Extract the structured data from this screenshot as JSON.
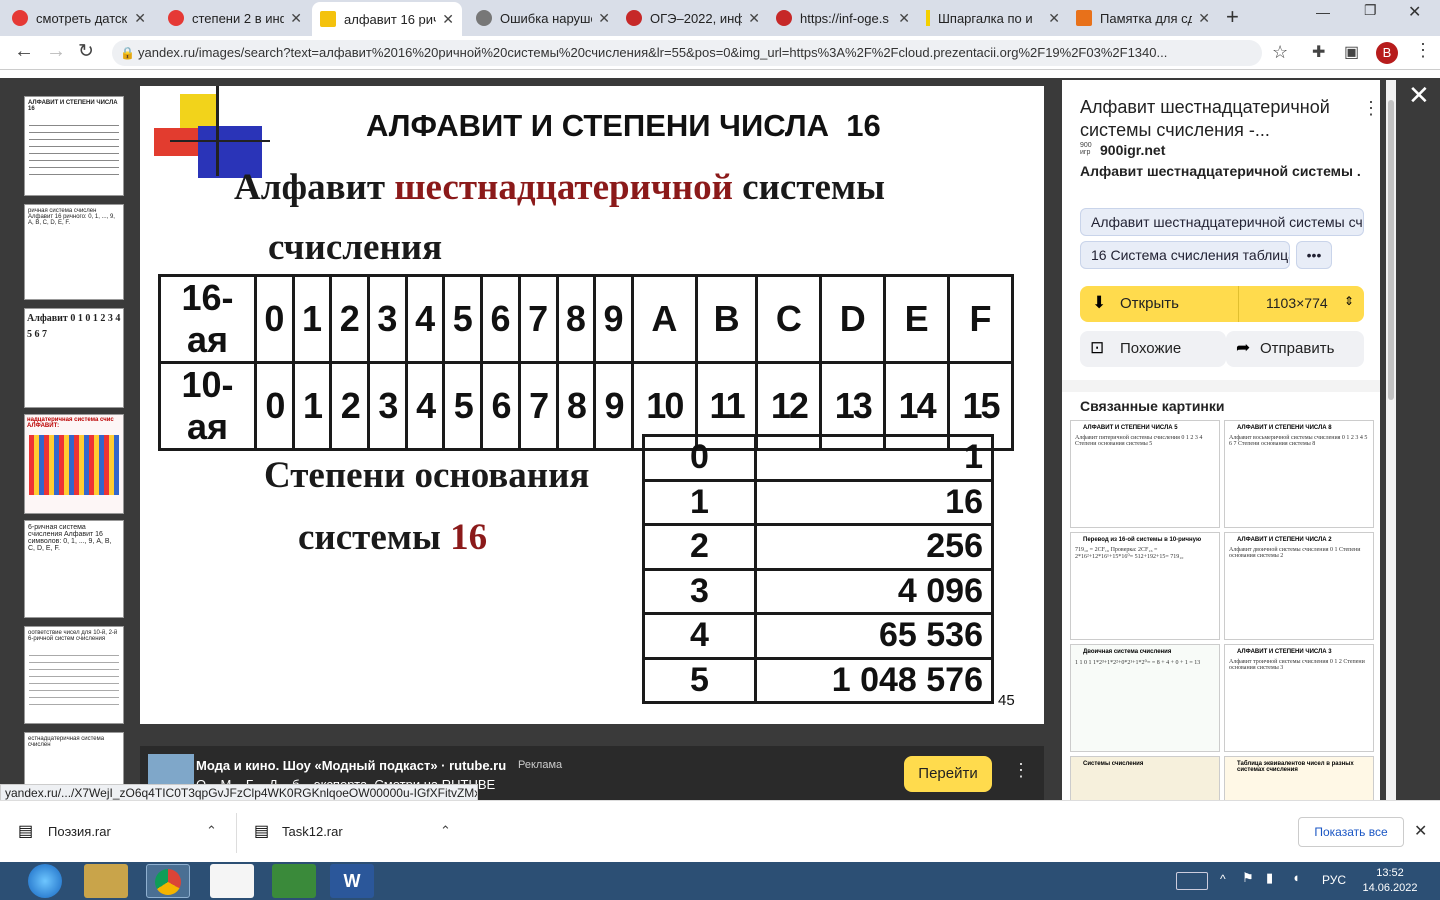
{
  "tabs": [
    {
      "label": "смотреть датск",
      "color": "#e53935"
    },
    {
      "label": "степени 2 в инф",
      "color": "#e53935"
    },
    {
      "label": "алфавит 16 рич",
      "color": "#f4c20d"
    },
    {
      "label": "Ошибка наруше",
      "color": "#777777"
    },
    {
      "label": "ОГЭ–2022, инф",
      "color": "#c62828"
    },
    {
      "label": "https://inf-oge.s",
      "color": "#c62828"
    },
    {
      "label": "Шпаргалка по и",
      "color": "#f4d000"
    },
    {
      "label": "Памятка для сд",
      "color": "#e8711a"
    }
  ],
  "address": "yandex.ru/images/search?text=алфавит%2016%20ричной%20системы%20счисления&lr=55&pos=0&img_url=https%3A%2F%2Fcloud.prezentacii.org%2F19%2F03%2F1340...",
  "profile_letter": "В",
  "thumbs": [
    {
      "text": "АЛФАВИТ И СТЕПЕНИ ЧИСЛА 16"
    },
    {
      "text": "ричная система счислен Алфавит 16 ричного: 0, 1, ..., 9, A, B, C, D, E, F."
    },
    {
      "text": "Алфавит 0 1 0 1 2 3 4 5 6 7"
    },
    {
      "text": "надцатеричная система счис АЛФАВИТ:"
    },
    {
      "text": "6-ричная система счисления Алфавит 16 символов: 0, 1, ..., 9, A, B, C, D, E, F."
    },
    {
      "text": "оответствие чисел для 10-й, 2-й 6-ричной систем счисления"
    },
    {
      "text": "естнадцатеричная система счислен"
    }
  ],
  "slide": {
    "title": "АЛФАВИТ И СТЕПЕНИ ЧИСЛА  16",
    "subtitle_part1": "Алфавит ",
    "subtitle_accent": "шестнадцатеричной",
    "subtitle_part2": " системы",
    "subtitle_line2": "счисления",
    "hex_row_label": "16-ая",
    "dec_row_label": "10-ая",
    "hex_digits": [
      "0",
      "1",
      "2",
      "3",
      "4",
      "5",
      "6",
      "7",
      "8",
      "9",
      "A",
      "B",
      "C",
      "D",
      "E",
      "F"
    ],
    "dec_values": [
      "0",
      "1",
      "2",
      "3",
      "4",
      "5",
      "6",
      "7",
      "8",
      "9",
      "10",
      "11",
      "12",
      "13",
      "14",
      "15"
    ],
    "powers_title_line1": "Степени основания",
    "powers_title_line2": "системы ",
    "powers_base": "16",
    "exponents": [
      "0",
      "1",
      "2",
      "3",
      "4",
      "5"
    ],
    "powers": [
      "1",
      "16",
      "256",
      "4 096",
      "65 536",
      "1 048 576"
    ],
    "page_number": "45"
  },
  "panel": {
    "title": "Алфавит шестнадцатеричной системы счисления -...",
    "site_badge": "900 игр",
    "site": "900igr.net",
    "description_part1": "Алфавит ",
    "description_bold": "шестнадцатеричной системы ...",
    "chip1": "Алфавит шестнадцатеричной системы сч...",
    "chip2": "16 Система счисления таблица",
    "chip_more": "•••",
    "open_label": "Открыть",
    "size_label": "1103×774",
    "similar_label": "Похожие",
    "share_label": "Отправить",
    "related_heading": "Связанные картинки",
    "related": [
      {
        "title": "АЛФАВИТ И СТЕПЕНИ ЧИСЛА 5",
        "body": "Алфавит пятеричной системы счисления 0 1 2 3 4 Степени основания системы 5"
      },
      {
        "title": "АЛФАВИТ И СТЕПЕНИ ЧИСЛА 8",
        "body": "Алфавит восьмеричной системы счисления 0 1 2 3 4 5 6 7 Степени основания системы 8"
      },
      {
        "title": "Перевод из 16-ой системы в 10-ричную",
        "body": "719₁₀ = 2CF₁₆ Проверка: 2CF₁₆ = 2*16²+12*16¹+15*16⁰= 512+192+15= 719₁₀"
      },
      {
        "title": "АЛФАВИТ И СТЕПЕНИ ЧИСЛА 2",
        "body": "Алфавит двоичной системы счисления 0 1 Степени основания системы 2"
      },
      {
        "title": "Двоичная система счисления",
        "body": "1 1 0 1  1*2³+1*2²+0*2¹+1*2⁰= = 8 + 4 + 0 + 1 = 13"
      },
      {
        "title": "АЛФАВИТ И СТЕПЕНИ ЧИСЛА 3",
        "body": "Алфавит троичной системы счисления 0 1 2 Степени основания системы 3"
      },
      {
        "title": "Системы счисления",
        "body": ""
      },
      {
        "title": "Таблица эквивалентов чисел в разных системах счисления",
        "body": ""
      }
    ]
  },
  "ad": {
    "title": "Мода и кино. Шоу «Модный подкаст» · rutube.ru",
    "tag": "Реклама",
    "text": "О... М... Б... Д... б... эксперта. Смотри на RUTUBE",
    "button": "Перейти"
  },
  "status_url": "yandex.ru/.../X7WejI_zO6q4TIC0T3qpGvJFzClp4WK0RGKnlqoeOW00000u-IGfXFitvZMx...",
  "downloads": [
    {
      "name": "Поэзия.rar"
    },
    {
      "name": "Task12.rar"
    }
  ],
  "show_all": "Показать все",
  "clock": {
    "time": "13:52",
    "date": "14.06.2022"
  },
  "lang": "РУС",
  "colors": {
    "accent_red": "#8b1a1a",
    "yandex_yellow": "#ffdb4d",
    "taskbar": "#2c4f74"
  }
}
